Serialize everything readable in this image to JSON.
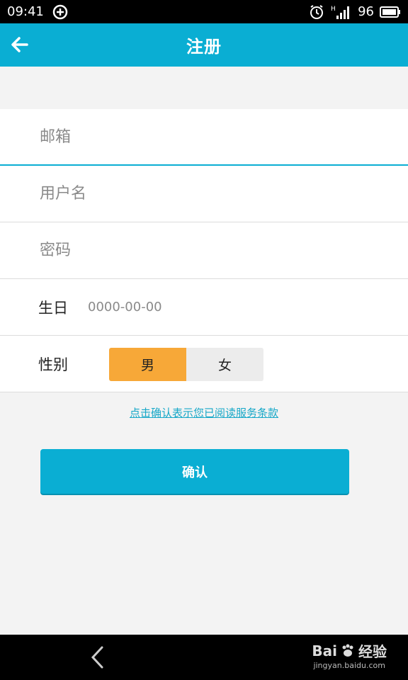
{
  "status_bar": {
    "time": "09:41",
    "network": "H",
    "battery": "96"
  },
  "app_bar": {
    "title": "注册"
  },
  "form": {
    "email_placeholder": "邮箱",
    "username_placeholder": "用户名",
    "password_placeholder": "密码",
    "birthday_label": "生日",
    "birthday_value": "0000-00-00",
    "gender_label": "性别",
    "gender_options": [
      "男",
      "女"
    ],
    "gender_selected": "男"
  },
  "terms_text": "点击确认表示您已阅读服务条款",
  "confirm_label": "确认",
  "watermark": {
    "brand": "Bai",
    "brand2": "经验",
    "url": "jingyan.baidu.com"
  },
  "colors": {
    "accent": "#0aaed3",
    "selected": "#f7a838"
  }
}
